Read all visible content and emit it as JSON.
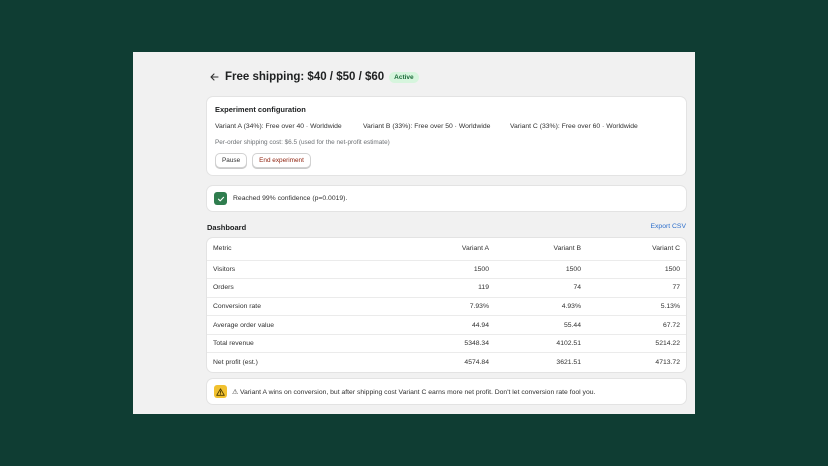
{
  "header": {
    "back_icon": "arrow-left-icon",
    "title": "Free shipping: $40 / $50 / $60",
    "status": "Active",
    "status_color": "#d6f5dd"
  },
  "config": {
    "title": "Experiment configuration",
    "variants": [
      "Variant A (34%): Free over 40 · Worldwide",
      "Variant B (33%): Free over 50 · Worldwide",
      "Variant C (33%): Free over 60 · Worldwide"
    ],
    "note": "Per-order shipping cost: $6.5 (used for the net-profit estimate)",
    "pause_label": "Pause",
    "end_label": "End experiment"
  },
  "confidence": {
    "icon": "checkmark-icon",
    "text": "Reached 99% confidence (p=0.0019)."
  },
  "dashboard": {
    "title": "Dashboard",
    "export_label": "Export CSV",
    "columns": [
      "Metric",
      "Variant A",
      "Variant B",
      "Variant C"
    ],
    "rows": [
      [
        "Visitors",
        "1500",
        "1500",
        "1500"
      ],
      [
        "Orders",
        "119",
        "74",
        "77"
      ],
      [
        "Conversion rate",
        "7.93%",
        "4.93%",
        "5.13%"
      ],
      [
        "Average order value",
        "44.94",
        "55.44",
        "67.72"
      ],
      [
        "Total revenue",
        "5348.34",
        "4102.51",
        "5214.22"
      ],
      [
        "Net profit (est.)",
        "4574.84",
        "3621.51",
        "4713.72"
      ]
    ]
  },
  "warning": {
    "icon": "warning-icon",
    "text": "⚠ Variant A wins on conversion, but after shipping cost Variant C earns more net profit. Don't let conversion rate fool you."
  },
  "colors": {
    "background": "#0f3d33",
    "accent_green": "#2f7d4e",
    "warning_yellow": "#f1c12f",
    "link_blue": "#2c6ecb"
  }
}
